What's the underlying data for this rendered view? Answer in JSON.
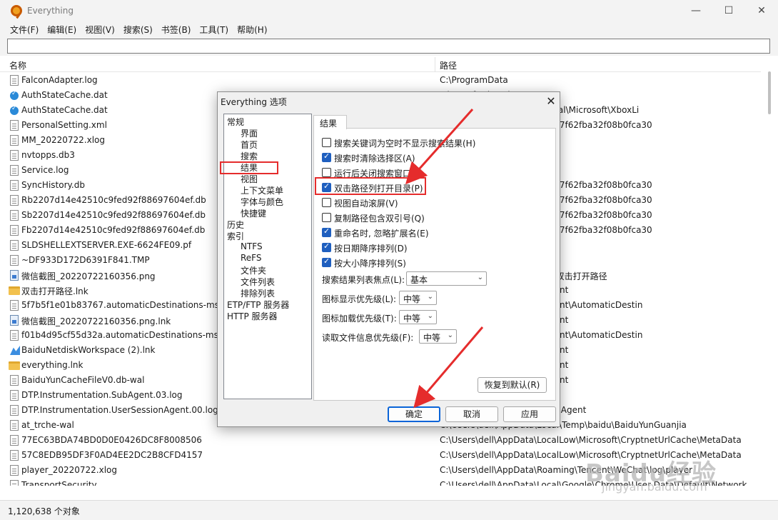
{
  "app": {
    "title": "Everything",
    "min_glyph": "—",
    "max_glyph": "☐",
    "close_glyph": "✕",
    "menu": [
      "文件(F)",
      "编辑(E)",
      "视图(V)",
      "搜索(S)",
      "书签(B)",
      "工具(T)",
      "帮助(H)"
    ],
    "search": {
      "value": "",
      "placeholder": ""
    },
    "columns": {
      "name": "名称",
      "path": "路径"
    },
    "status": "1,120,638 个对象"
  },
  "files": [
    {
      "name": "FalconAdapter.log",
      "path": "C:\\ProgramData",
      "icon": "file"
    },
    {
      "name": "AuthStateCache.dat",
      "path": "Microsoft\\XboxLive",
      "icon": "blue"
    },
    {
      "name": "AuthStateCache.dat",
      "path": "\\systemprofile\\AppData\\Local\\Microsoft\\XboxLi",
      "icon": "blue"
    },
    {
      "name": "PersonalSetting.xml",
      "path": "Netdisk\\users\\0041ceeeb297f62fba32f08b0fca30",
      "icon": "file"
    },
    {
      "name": "MM_20220722.xlog",
      "path": "ing\\Tencent\\WeChat\\log",
      "icon": "file"
    },
    {
      "name": "nvtopps.db3",
      "path": "oration\\nvtopps",
      "icon": "file"
    },
    {
      "name": "Service.log",
      "path": "Service\\Log",
      "icon": "file"
    },
    {
      "name": "SyncHistory.db",
      "path": "Netdisk\\users\\0041ceeeb297f62fba32f08b0fca30",
      "icon": "file"
    },
    {
      "name": "Rb2207d14e42510c9fed92f88697604ef.db",
      "path": "Netdisk\\users\\0041ceeeb297f62fba32f08b0fca30",
      "icon": "file"
    },
    {
      "name": "Sb2207d14e42510c9fed92f88697604ef.db",
      "path": "Netdisk\\users\\0041ceeeb297f62fba32f08b0fca30",
      "icon": "file"
    },
    {
      "name": "Fb2207d14e42510c9fed92f88697604ef.db",
      "path": "Netdisk\\users\\0041ceeeb297f62fba32f08b0fca30",
      "icon": "file"
    },
    {
      "name": "SLDSHELLEXTSERVER.EXE-6624FE09.pf",
      "path": "",
      "icon": "file"
    },
    {
      "name": "~DF933D172D6391F841.TMP",
      "path": "Temp",
      "icon": "file"
    },
    {
      "name": "微信截图_20220722160356.png",
      "path": "diskWorkspace\\everything\\双击打开路径",
      "icon": "img"
    },
    {
      "name": "双击打开路径.lnk",
      "path": "ing\\Microsoft\\Windows\\Recent",
      "icon": "folder"
    },
    {
      "name": "5f7b5f1e01b83767.automaticDestinations-ms",
      "path": "ing\\Microsoft\\Windows\\Recent\\AutomaticDestin",
      "icon": "file"
    },
    {
      "name": "微信截图_20220722160356.png.lnk",
      "path": "ing\\Microsoft\\Windows\\Recent",
      "icon": "img"
    },
    {
      "name": "f01b4d95cf55d32a.automaticDestinations-ms",
      "path": "ing\\Microsoft\\Windows\\Recent\\AutomaticDestin",
      "icon": "file"
    },
    {
      "name": "BaiduNetdiskWorkspace (2).lnk",
      "path": "ing\\Microsoft\\Windows\\Recent",
      "icon": "net"
    },
    {
      "name": "everything.lnk",
      "path": "ing\\Microsoft\\Windows\\Recent",
      "icon": "folder"
    },
    {
      "name": "BaiduYunCacheFileV0.db-wal",
      "path": "ing\\Microsoft\\Windows\\Recent",
      "icon": "file"
    },
    {
      "name": "DTP.Instrumentation.SubAgent.03.log",
      "path": "nstrumentation.SubAgent",
      "icon": "file"
    },
    {
      "name": "DTP.Instrumentation.UserSessionAgent.00.log",
      "path": "nstrumentation.UserSessionAgent",
      "icon": "file"
    },
    {
      "name": "at_trche-wal",
      "path": "C:\\Users\\dell\\AppData\\Local\\Temp\\baidu\\BaiduYunGuanjia",
      "icon": "file"
    },
    {
      "name": "77EC63BDA74BD0D0E0426DC8F8008506",
      "path": "C:\\Users\\dell\\AppData\\LocalLow\\Microsoft\\CryptnetUrlCache\\MetaData",
      "icon": "file"
    },
    {
      "name": "57C8EDB95DF3F0AD4EE2DC2B8CFD4157",
      "path": "C:\\Users\\dell\\AppData\\LocalLow\\Microsoft\\CryptnetUrlCache\\MetaData",
      "icon": "file"
    },
    {
      "name": "player_20220722.xlog",
      "path": "C:\\Users\\dell\\AppData\\Roaming\\Tencent\\WeChat\\log\\player",
      "icon": "file"
    },
    {
      "name": "TransportSecurity",
      "path": "C:\\Users\\dell\\AppData\\Local\\Google\\Chrome\\User Data\\Default\\Network",
      "icon": "file"
    }
  ],
  "dialog": {
    "title": "Everything 选项",
    "close_glyph": "✕",
    "tree": [
      "常规",
      "界面",
      "首页",
      "搜索",
      "结果",
      "视图",
      "上下文菜单",
      "字体与颜色",
      "快捷键",
      "历史",
      "索引",
      "NTFS",
      "ReFS",
      "文件夹",
      "文件列表",
      "排除列表",
      "ETP/FTP 服务器",
      "HTTP 服务器"
    ],
    "tab": "结果",
    "options": [
      {
        "label": "搜索关键词为空时不显示搜索结果(H)",
        "checked": false
      },
      {
        "label": "搜索时清除选择区(A)",
        "checked": true
      },
      {
        "label": "运行后关闭搜索窗口(E)",
        "checked": false
      },
      {
        "label": "双击路径列打开目录(P)",
        "checked": true
      },
      {
        "label": "视图自动滚屏(V)",
        "checked": false
      },
      {
        "label": "复制路径包含双引号(Q)",
        "checked": false
      },
      {
        "label": "重命名时, 忽略扩展名(E)",
        "checked": true
      },
      {
        "label": "按日期降序排列(D)",
        "checked": true
      },
      {
        "label": "按大小降序排列(S)",
        "checked": true
      }
    ],
    "selects": [
      {
        "label": "搜索结果列表焦点(L):",
        "value": "基本"
      },
      {
        "label": "图标显示优先级(L):",
        "value": "中等"
      },
      {
        "label": "图标加载优先级(T):",
        "value": "中等"
      },
      {
        "label": "读取文件信息优先级(F):",
        "value": "中等"
      }
    ],
    "chevron_glyph": "⌄",
    "restore_button": "恢复到默认(R)",
    "ok_button": "确定",
    "cancel_button": "取消",
    "apply_button": "应用"
  },
  "watermark": {
    "main": "Baidu经验",
    "sub": "jingyan.baidu.com"
  },
  "colors": {
    "highlight": "#e52c2c",
    "checkbox": "#1f5fbf",
    "primary_border": "#0a64d8"
  }
}
